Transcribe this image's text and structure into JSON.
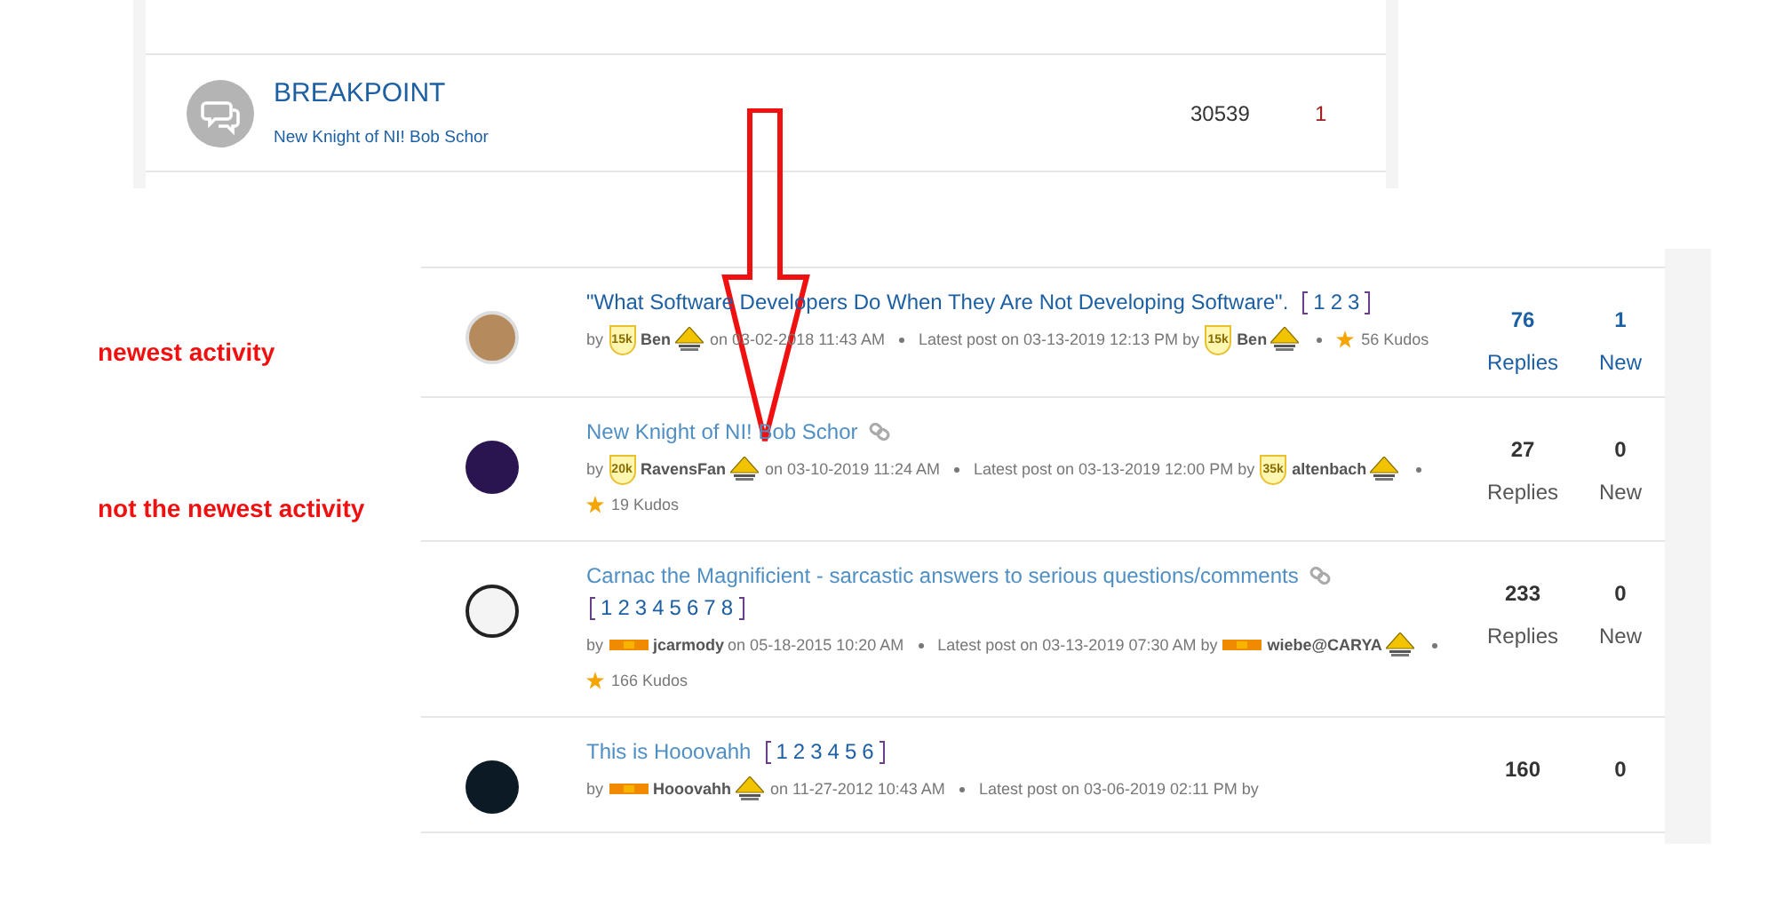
{
  "board_row": {
    "title": "BREAKPOINT",
    "latest_topic": "New Knight of NI! Bob Schor",
    "count_1": "30539",
    "count_2": "1"
  },
  "annotations": [
    {
      "text": "newest activity"
    },
    {
      "text": "not the newest activity"
    }
  ],
  "topics": [
    {
      "title": "\"What Software Developers Do When They Are Not Developing Software\".",
      "unread": true,
      "linked": false,
      "pages": [
        "1",
        "2",
        "3"
      ],
      "author": {
        "prefix": "by",
        "rank": {
          "kind": "shield",
          "label": "15k"
        },
        "name": "Ben",
        "award": true
      },
      "posted": "on 03-02-2018 11:43 AM",
      "latest": "Latest post on 03-13-2019 12:13 PM by",
      "last_author": {
        "rank": {
          "kind": "shield",
          "label": "15k"
        },
        "name": "Ben",
        "award": true
      },
      "kudos": "56 Kudos",
      "replies": "76",
      "replies_label": "Replies",
      "new": "1",
      "new_label": "New"
    },
    {
      "title": "New Knight of NI! Bob Schor",
      "unread": false,
      "linked": true,
      "author": {
        "prefix": "by",
        "rank": {
          "kind": "shield",
          "label": "20k"
        },
        "name": "RavensFan",
        "award": true
      },
      "posted": "on 03-10-2019 11:24 AM",
      "latest": "Latest post on 03-13-2019 12:00 PM by",
      "last_author": {
        "rank": {
          "kind": "shield",
          "label": "35k"
        },
        "name": "altenbach",
        "award": true
      },
      "kudos": "19 Kudos",
      "replies": "27",
      "replies_label": "Replies",
      "new": "0",
      "new_label": "New"
    },
    {
      "title": "Carnac the Magnificient - sarcastic answers to serious questions/comments",
      "unread": false,
      "linked": true,
      "pages": [
        "1",
        "2",
        "3",
        "4",
        "5",
        "6",
        "7",
        "8"
      ],
      "author": {
        "prefix": "by",
        "rank": {
          "kind": "bar"
        },
        "name": "jcarmody",
        "award": false
      },
      "posted": "on 05-18-2015 10:20 AM",
      "latest": "Latest post on 03-13-2019 07:30 AM by",
      "last_author": {
        "rank": {
          "kind": "bar"
        },
        "name": "wiebe@CARYA",
        "award": true
      },
      "kudos": "166 Kudos",
      "replies": "233",
      "replies_label": "Replies",
      "new": "0",
      "new_label": "New"
    },
    {
      "title": "This is Hooovahh",
      "unread": false,
      "linked": false,
      "pages": [
        "1",
        "2",
        "3",
        "4",
        "5",
        "6"
      ],
      "author": {
        "prefix": "by",
        "rank": {
          "kind": "bar"
        },
        "name": "Hooovahh",
        "award": true
      },
      "posted": "on 11-27-2012 10:43 AM",
      "latest": "Latest post on 03-06-2019 02:11 PM by",
      "replies": "160",
      "new": "0"
    }
  ]
}
